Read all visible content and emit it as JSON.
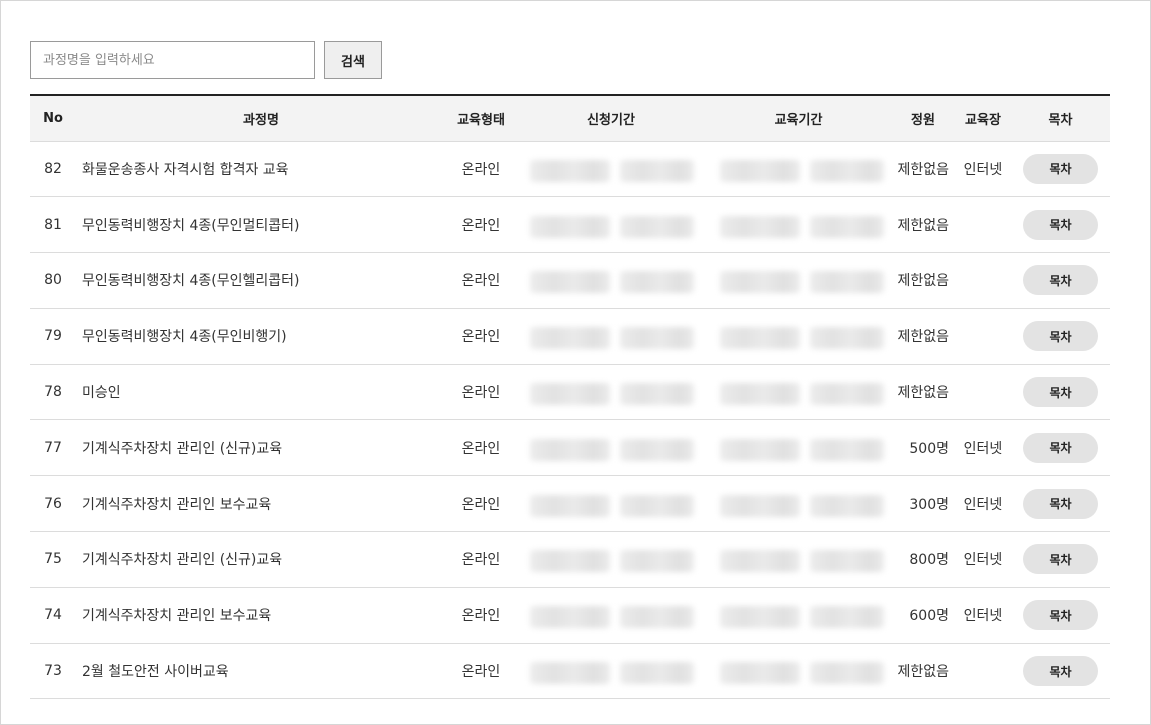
{
  "search": {
    "placeholder": "과정명을 입력하세요",
    "value": "",
    "button_label": "검색"
  },
  "table": {
    "headers": {
      "no": "No",
      "title": "과정명",
      "type": "교육형태",
      "apply": "신청기간",
      "period": "교육기간",
      "capacity": "정원",
      "place": "교육장",
      "toc": "목차"
    },
    "rows": [
      {
        "no": "82",
        "title": "화물운송종사 자격시험 합격자 교육",
        "type": "온라인",
        "capacity": "제한없음",
        "place": "인터넷",
        "toc": "목차"
      },
      {
        "no": "81",
        "title": "무인동력비행장치 4종(무인멀티콥터)",
        "type": "온라인",
        "capacity": "제한없음",
        "place": "",
        "toc": "목차"
      },
      {
        "no": "80",
        "title": "무인동력비행장치 4종(무인헬리콥터)",
        "type": "온라인",
        "capacity": "제한없음",
        "place": "",
        "toc": "목차"
      },
      {
        "no": "79",
        "title": "무인동력비행장치 4종(무인비행기)",
        "type": "온라인",
        "capacity": "제한없음",
        "place": "",
        "toc": "목차"
      },
      {
        "no": "78",
        "title": "미승인",
        "type": "온라인",
        "capacity": "제한없음",
        "place": "",
        "toc": "목차"
      },
      {
        "no": "77",
        "title": "기계식주차장치 관리인 (신규)교육",
        "type": "온라인",
        "capacity": "500명",
        "place": "인터넷",
        "toc": "목차"
      },
      {
        "no": "76",
        "title": "기계식주차장치 관리인 보수교육",
        "type": "온라인",
        "capacity": "300명",
        "place": "인터넷",
        "toc": "목차"
      },
      {
        "no": "75",
        "title": "기계식주차장치 관리인 (신규)교육",
        "type": "온라인",
        "capacity": "800명",
        "place": "인터넷",
        "toc": "목차"
      },
      {
        "no": "74",
        "title": "기계식주차장치 관리인 보수교육",
        "type": "온라인",
        "capacity": "600명",
        "place": "인터넷",
        "toc": "목차"
      },
      {
        "no": "73",
        "title": "2월 철도안전 사이버교육",
        "type": "온라인",
        "capacity": "제한없음",
        "place": "",
        "toc": "목차"
      }
    ]
  }
}
